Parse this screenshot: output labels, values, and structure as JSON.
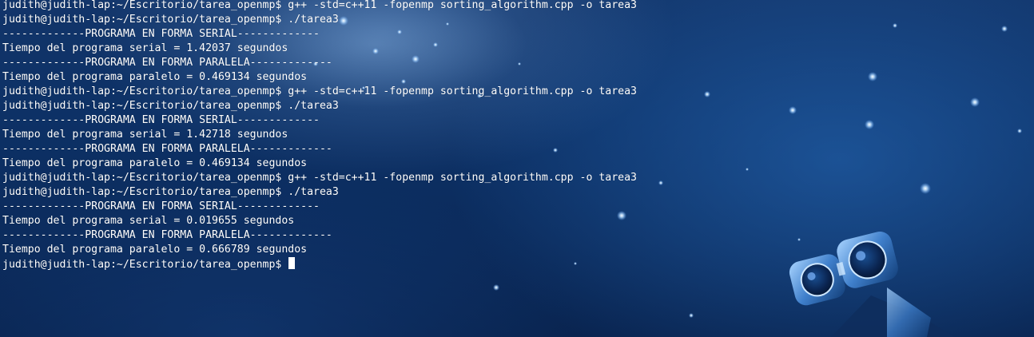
{
  "terminal": {
    "lines": [
      "judith@judith-lap:~/Escritorio/tarea_openmp$ g++ -std=c++11 -fopenmp sorting_algorithm.cpp -o tarea3",
      "judith@judith-lap:~/Escritorio/tarea_openmp$ ./tarea3",
      "-------------PROGRAMA EN FORMA SERIAL-------------",
      "Tiempo del programa serial = 1.42037 segundos",
      "-------------PROGRAMA EN FORMA PARALELA-------------",
      "Tiempo del programa paralelo = 0.469134 segundos",
      "judith@judith-lap:~/Escritorio/tarea_openmp$ g++ -std=c++11 -fopenmp sorting_algorithm.cpp -o tarea3",
      "judith@judith-lap:~/Escritorio/tarea_openmp$ ./tarea3",
      "-------------PROGRAMA EN FORMA SERIAL-------------",
      "Tiempo del programa serial = 1.42718 segundos",
      "-------------PROGRAMA EN FORMA PARALELA-------------",
      "Tiempo del programa paralelo = 0.469134 segundos",
      "judith@judith-lap:~/Escritorio/tarea_openmp$ g++ -std=c++11 -fopenmp sorting_algorithm.cpp -o tarea3",
      "judith@judith-lap:~/Escritorio/tarea_openmp$ ./tarea3",
      "-------------PROGRAMA EN FORMA SERIAL-------------",
      "Tiempo del programa serial = 0.019655 segundos",
      "-------------PROGRAMA EN FORMA PARALELA-------------",
      "Tiempo del programa paralelo = 0.666789 segundos"
    ],
    "prompt": "judith@judith-lap:~/Escritorio/tarea_openmp$ ",
    "background": {
      "image_subject": "starry-space-robot-wallpaper"
    },
    "colors": {
      "text": "#ffffff",
      "background": "#0d3166",
      "star": "#cfe6ff"
    }
  }
}
